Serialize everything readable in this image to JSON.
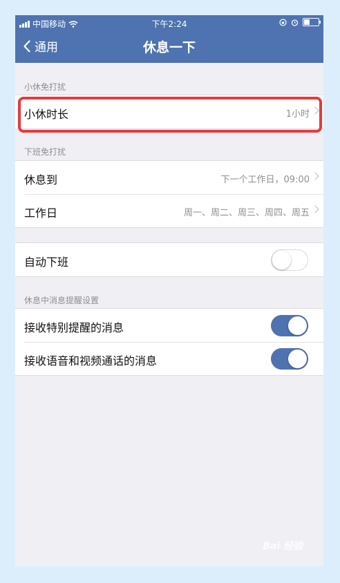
{
  "status": {
    "carrier": "中国移动",
    "time": "下午2:24"
  },
  "nav": {
    "back_label": "通用",
    "title": "休息一下"
  },
  "sections": {
    "short_break": {
      "header": "小休免打扰",
      "rows": [
        {
          "label": "小休时长",
          "value": "1小时"
        }
      ]
    },
    "after_work": {
      "header": "下班免打扰",
      "rows": [
        {
          "label": "休息到",
          "value": "下一个工作日，09:00"
        },
        {
          "label": "工作日",
          "value": "周一、周二、周三、周四、周五"
        }
      ]
    },
    "auto_off": {
      "rows": [
        {
          "label": "自动下班",
          "toggle": false
        }
      ]
    },
    "reminders": {
      "header": "休息中消息提醒设置",
      "rows": [
        {
          "label": "接收特别提醒的消息",
          "toggle": true
        },
        {
          "label": "接收语音和视频通话的消息",
          "toggle": true
        }
      ]
    }
  },
  "watermark": "Bai 经验",
  "colors": {
    "accent": "#4e73b0",
    "highlight": "#e8393c",
    "background": "#efeff4"
  }
}
